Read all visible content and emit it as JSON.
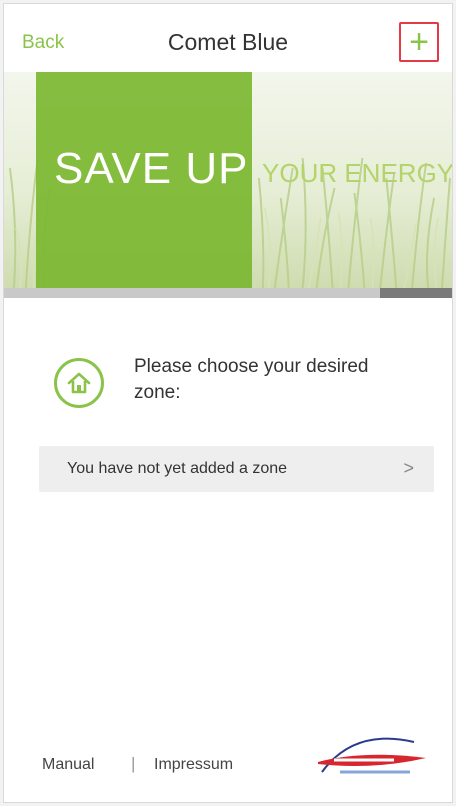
{
  "navbar": {
    "back_label": "Back",
    "title": "Comet Blue",
    "add_label": "+"
  },
  "banner": {
    "headline": "SAVE UP",
    "tagline": "YOUR ENERGY"
  },
  "progress": {
    "position_start": 0.84,
    "position_end": 1.0
  },
  "zone_prompt": {
    "text": "Please choose your desired zone:",
    "icon": "home-icon"
  },
  "zone_list": {
    "empty_label": "You have not yet added a zone",
    "chevron": ">"
  },
  "footer": {
    "manual_label": "Manual",
    "separator": "|",
    "impressum_label": "Impressum"
  },
  "colors": {
    "accent": "#8bc34a",
    "banner_green": "#7cb832",
    "highlight_border": "#e63946"
  }
}
